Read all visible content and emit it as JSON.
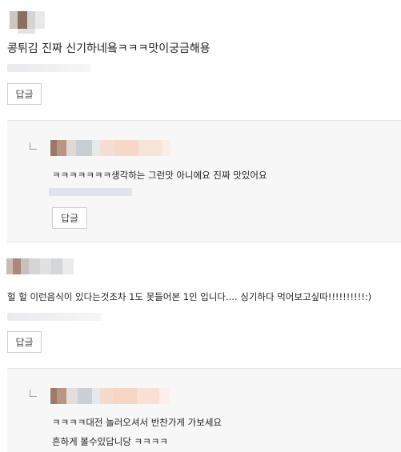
{
  "comments": [
    {
      "text": "콩튀김 진짜 신기하네욬ㅋㅋㅋ맛이궁금해용",
      "reply_button": "답글",
      "reply": {
        "text": "ㅋㅋㅋㅋㅋㅋㅋ생각하는 그런맛 아니에요 진짜 맛있어요",
        "reply_button": "답글"
      }
    },
    {
      "text": "헐 헐 이런음식이 있다는것조차 1도 못들어본 1인 입니다.... 싱기하다 먹어보고싶따!!!!!!!!!!:)",
      "reply_button": "답글",
      "reply": {
        "text_line1": "ㅋㅋㅋㅋ대전 놀러오셔서 반찬가게 가보세요",
        "text_line2": "흔하게 볼수있답니당 ㅋㅋㅋㅋ"
      }
    }
  ],
  "colors": {
    "reply_bg": "#f7f7f7",
    "border": "#cfcfcf",
    "text": "#222222"
  }
}
